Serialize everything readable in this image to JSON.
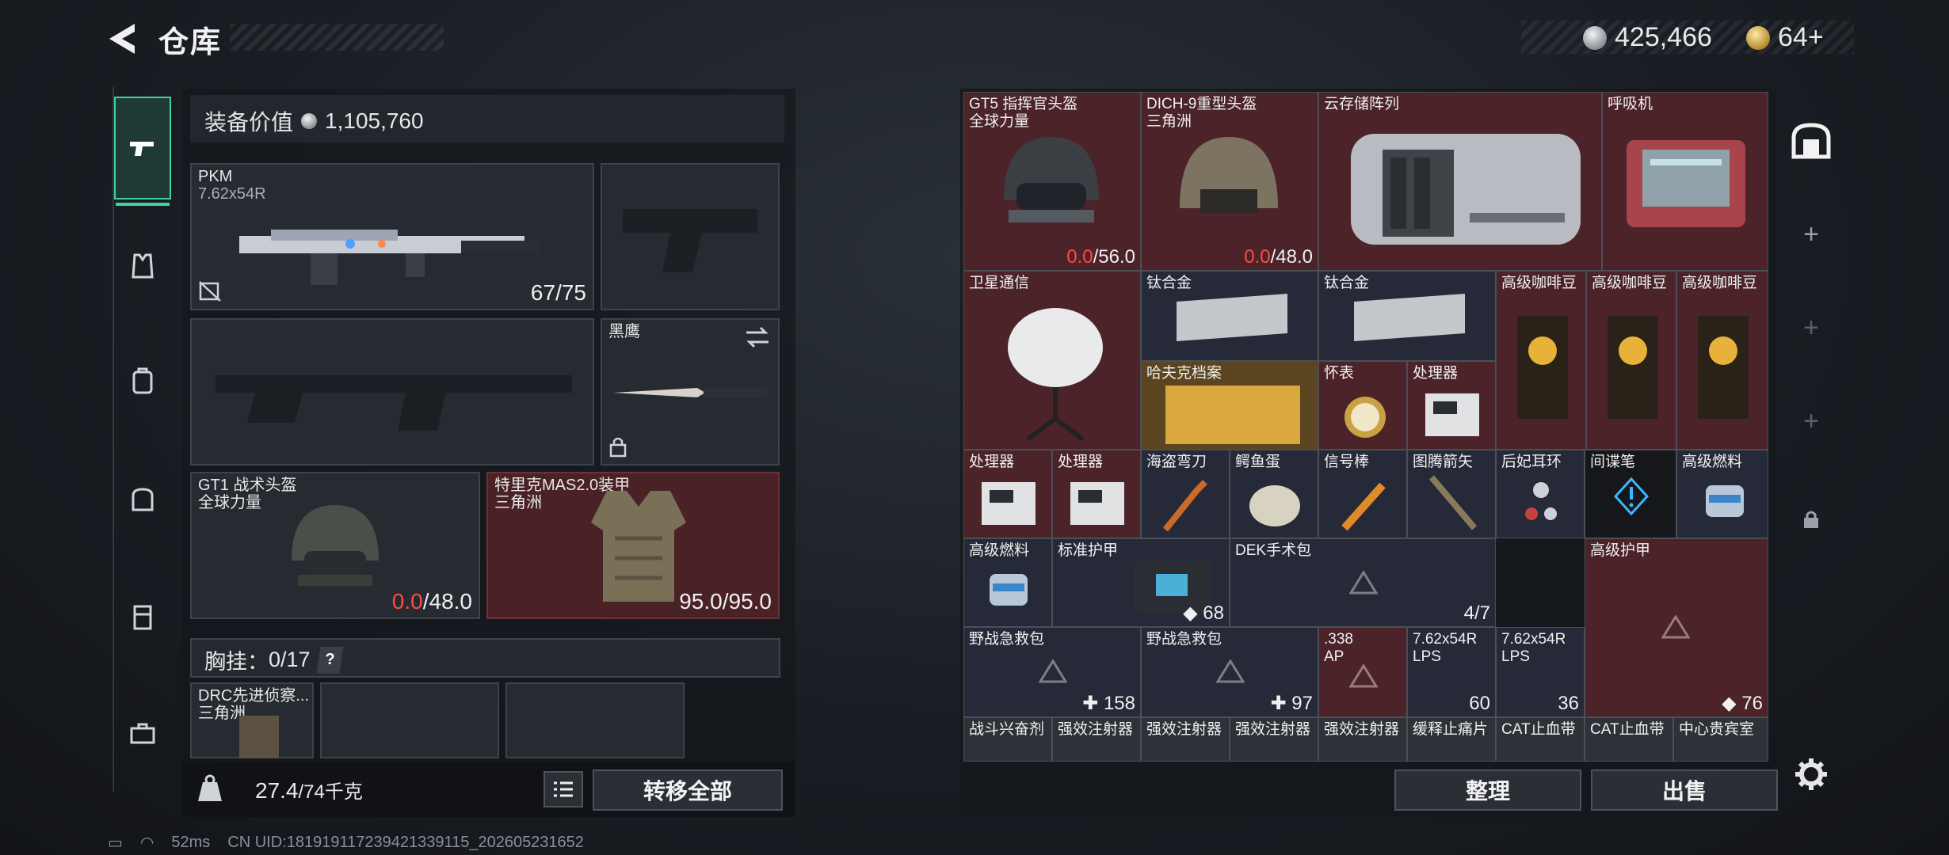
{
  "header": {
    "title": "仓库",
    "silver": "425,466",
    "gold": "64+"
  },
  "left": {
    "equip_label": "装备价值",
    "equip_value": "1,105,760",
    "primary": {
      "name": "PKM",
      "ammo": "7.62x54R",
      "count": "67/75"
    },
    "melee": {
      "name": "黑鹰"
    },
    "helmet": {
      "name": "GT1 战术头盔",
      "sub": "全球力量",
      "cur": "0.0",
      "max": "/48.0"
    },
    "armor": {
      "name": "特里克MAS2.0装甲",
      "sub": "三角洲",
      "val": "95.0/95.0"
    },
    "chest_label": "胸挂：",
    "chest_val": "0/17",
    "chest_help": "?",
    "rig": {
      "name": "DRC先进侦察...",
      "sub": "三角洲"
    },
    "weight": "27.4",
    "weight_max": "/74千克",
    "transfer_all": "转移全部"
  },
  "grid": {
    "gt5": {
      "name": "GT5 指挥官头盔",
      "sub": "全球力量",
      "cur": "0.0",
      "max": "/56.0"
    },
    "dich": {
      "name": "DICH-9重型头盔",
      "sub": "三角洲",
      "cur": "0.0",
      "max": "/48.0"
    },
    "cloud": {
      "name": "云存储阵列"
    },
    "resp": {
      "name": "呼吸机"
    },
    "sat": {
      "name": "卫星通信"
    },
    "ti1": {
      "name": "钛合金"
    },
    "ti2": {
      "name": "钛合金"
    },
    "coffee1": {
      "name": "高级咖啡豆"
    },
    "coffee2": {
      "name": "高级咖啡豆"
    },
    "coffee3": {
      "name": "高级咖啡豆"
    },
    "harvard": {
      "name": "哈夫克档案"
    },
    "watch": {
      "name": "怀表"
    },
    "proc1": {
      "name": "处理器"
    },
    "proc2": {
      "name": "处理器"
    },
    "proc3": {
      "name": "处理器"
    },
    "pirate": {
      "name": "海盗弯刀"
    },
    "croc": {
      "name": "鳄鱼蛋"
    },
    "flare": {
      "name": "信号棒"
    },
    "arrow": {
      "name": "图腾箭矢"
    },
    "earring": {
      "name": "后妃耳环"
    },
    "spy": {
      "name": "间谍笔"
    },
    "fuel1": {
      "name": "高级燃料"
    },
    "fuel2": {
      "name": "高级燃料"
    },
    "std_armor": {
      "name": "标准护甲",
      "val": "68"
    },
    "dek": {
      "name": "DEK手术包",
      "val": "4/7"
    },
    "adv_armor": {
      "name": "高级护甲",
      "val": "76"
    },
    "med1": {
      "name": "野战急救包",
      "val": "158"
    },
    "med2": {
      "name": "野战急救包",
      "val": "97"
    },
    "ap": {
      "name": ".338",
      "sub": "AP"
    },
    "lps1": {
      "name": "7.62x54R",
      "sub": "LPS",
      "val": "60"
    },
    "lps2": {
      "name": "7.62x54R",
      "sub": "LPS",
      "val": "36"
    },
    "row7": [
      "战斗兴奋剂",
      "强效注射器",
      "强效注射器",
      "强效注射器",
      "强效注射器",
      "缓释止痛片",
      "CAT止血带",
      "CAT止血带",
      "中心贵宾室"
    ],
    "sort": "整理",
    "sell": "出售"
  },
  "status": {
    "ping": "52ms",
    "uid": "CN UID:181919117239421339115_202605231652"
  },
  "colors": {
    "accent": "#3fd29a",
    "red_cell": "#4b2328",
    "blue_cell": "#262a38",
    "red_text": "#ff4a4a"
  }
}
